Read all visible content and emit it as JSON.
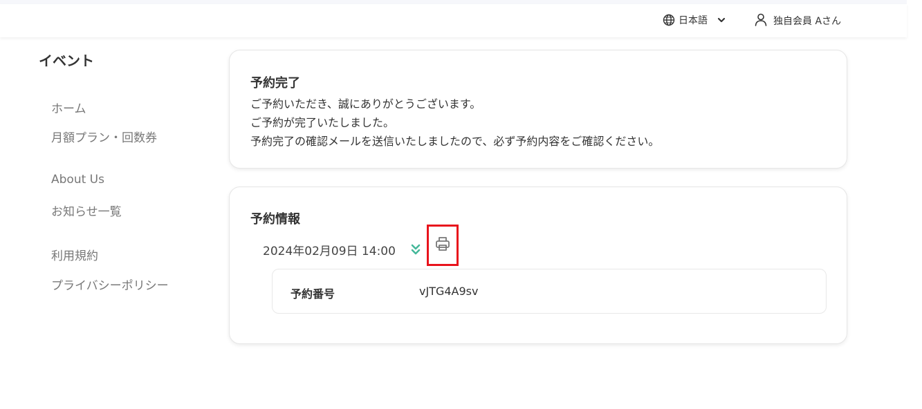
{
  "header": {
    "language_label": "日本語",
    "user_name": "独自会員 Aさん"
  },
  "sidebar": {
    "title": "イベント",
    "groups": [
      {
        "items": [
          "ホーム",
          "月額プラン・回数券"
        ]
      },
      {
        "items": [
          "About Us",
          "お知らせ一覧"
        ]
      },
      {
        "items": [
          "利用規約",
          "プライバシーポリシー"
        ]
      }
    ]
  },
  "completion": {
    "title": "予約完了",
    "lines": [
      "ご予約いただき、誠にありがとうございます。",
      "ご予約が完了いたしました。",
      "予約完了の確認メールを送信いたしましたので、必ず予約内容をご確認ください。"
    ]
  },
  "reservation": {
    "title": "予約情報",
    "datetime": "2024年02月09日 14:00",
    "fields": [
      {
        "label": "予約番号",
        "value": "vJTG4A9sv"
      }
    ]
  },
  "colors": {
    "accent_green": "#45b89a",
    "highlight_red": "#e8131c",
    "icon_gray": "#777777"
  },
  "icons": {
    "language": "globe-icon",
    "language_toggle": "chevron-down-icon",
    "user": "user-icon",
    "expand": "double-chevron-down-icon",
    "print": "printer-icon"
  }
}
